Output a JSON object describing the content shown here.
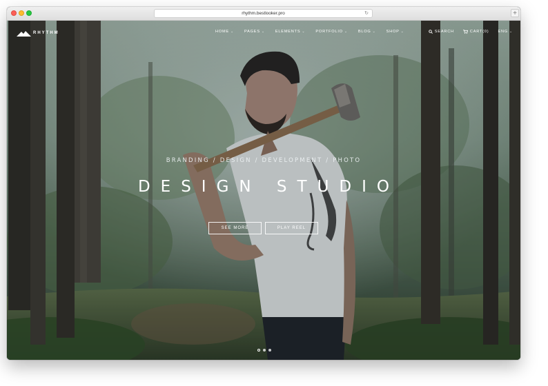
{
  "browser": {
    "url": "rhythm.bestlooker.pro"
  },
  "brand": {
    "name": "RHYTHM"
  },
  "nav": {
    "items": [
      {
        "label": "HOME"
      },
      {
        "label": "PAGES"
      },
      {
        "label": "ELEMENTS"
      },
      {
        "label": "PORTFOLIO"
      },
      {
        "label": "BLOG"
      },
      {
        "label": "SHOP"
      }
    ],
    "search": "SEARCH",
    "cart": "CART(0)",
    "language": "ENG"
  },
  "hero": {
    "tagline": "BRANDING / DESIGN / DEVELOPMENT / PHOTO",
    "title": "DESIGN STUDIO",
    "primary_button": "SEE MORE",
    "secondary_button": "PLAY REEL",
    "slides_total": 3,
    "active_slide": 1
  }
}
